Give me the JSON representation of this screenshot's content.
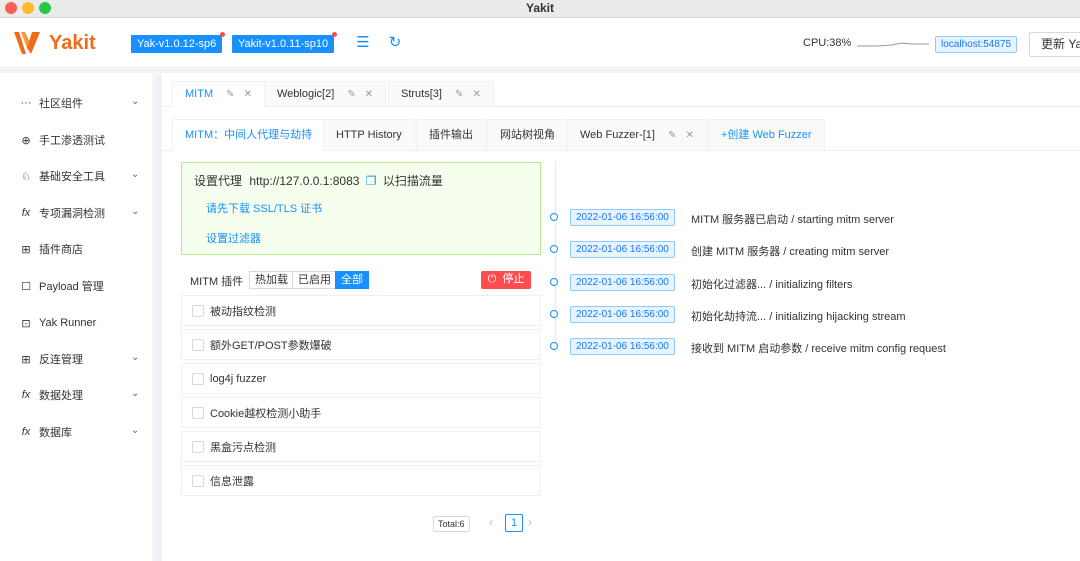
{
  "window": {
    "title": "Yakit"
  },
  "header": {
    "logo_text": "Yakit",
    "versions": [
      "Yak-v1.0.12-sp6",
      "Yakit-v1.0.11-sp10"
    ],
    "cpu": "CPU:38%",
    "host": "localhost:54875",
    "update_button": "更新 Yak"
  },
  "sidebar": {
    "items": [
      {
        "icon": "more-icon",
        "label": "社区组件",
        "expandable": true
      },
      {
        "icon": "aim-icon",
        "label": "手工渗透测试",
        "expandable": false
      },
      {
        "icon": "bug-icon",
        "label": "基础安全工具",
        "expandable": true
      },
      {
        "icon": "fx-icon",
        "label": "专项漏洞检测",
        "expandable": true
      },
      {
        "icon": "apps-icon",
        "label": "插件商店",
        "expandable": false
      },
      {
        "icon": "doc-icon",
        "label": "Payload 管理",
        "expandable": false
      },
      {
        "icon": "terminal-icon",
        "label": "Yak Runner",
        "expandable": false
      },
      {
        "icon": "apps-icon",
        "label": "反连管理",
        "expandable": true
      },
      {
        "icon": "fx-icon",
        "label": "数据处理",
        "expandable": true
      },
      {
        "icon": "fx-icon",
        "label": "数据库",
        "expandable": true
      }
    ]
  },
  "tabs": [
    {
      "label": "MITM",
      "active": true
    },
    {
      "label": "Weblogic[2]",
      "active": false
    },
    {
      "label": "Struts[3]",
      "active": false
    }
  ],
  "subtabs": [
    {
      "label": "MITM：中间人代理与劫持",
      "active": true
    },
    {
      "label": "HTTP History",
      "active": false
    },
    {
      "label": "插件输出",
      "active": false
    },
    {
      "label": "网站树视角",
      "active": false
    },
    {
      "label": "Web Fuzzer-[1]",
      "active": false
    },
    {
      "label": "+创建 Web Fuzzer",
      "active": false
    }
  ],
  "proxy": {
    "prefix": "设置代理",
    "address": "http://127.0.0.1:8083",
    "suffix": "以扫描流量",
    "download_cert": "请先下载 SSL/TLS 证书",
    "set_filter": "设置过滤器"
  },
  "plugins": {
    "title": "MITM 插件",
    "filters": [
      "热加载",
      "已启用",
      "全部"
    ],
    "active_filter": "全部",
    "stop_label": "停止",
    "items": [
      "被动指纹检测",
      "额外GET/POST参数爆破",
      "log4j fuzzer",
      "Cookie越权检测小助手",
      "黑盒污点检测",
      "信息泄露"
    ],
    "total": "Total:6",
    "page": "1"
  },
  "timeline": [
    {
      "time": "2022-01-06 16:56:00",
      "text": "MITM 服务器已启动 / starting mitm server"
    },
    {
      "time": "2022-01-06 16:56:00",
      "text": "创建 MITM 服务器 / creating mitm server"
    },
    {
      "time": "2022-01-06 16:56:00",
      "text": "初始化过滤器... / initializing filters"
    },
    {
      "time": "2022-01-06 16:56:00",
      "text": "初始化劫持流... / initializing hijacking stream"
    },
    {
      "time": "2022-01-06 16:56:00",
      "text": "接收到 MITM 启动参数 / receive mitm config request"
    }
  ],
  "colors": {
    "brand": "#ef6b1b",
    "accent": "#1890ff",
    "danger": "#ff4d4f",
    "success_bg": "#f6ffed"
  }
}
